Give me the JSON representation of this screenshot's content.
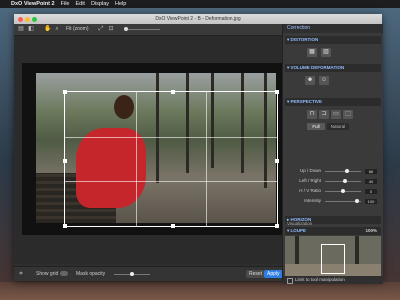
{
  "menubar": {
    "apple": "",
    "app_name": "DxO ViewPoint 2",
    "items": [
      "File",
      "Edit",
      "Display",
      "Help"
    ]
  },
  "window": {
    "title": "DxO ViewPoint 2 - B - Deformation.jpg"
  },
  "toolbar": {
    "zoom_label": "Fit (zoom)"
  },
  "canvas": {
    "dimensions": "2272 × 1515 px"
  },
  "bottombar": {
    "show_grid_label": "Show grid",
    "mask_opacity_label": "Mask opacity",
    "mask_opacity": 0.5,
    "reset_label": "Reset",
    "apply_label": "Apply"
  },
  "panel": {
    "header": "Correction",
    "sections": {
      "distortion": "DISTORTION",
      "volume": "VOLUME DEFORMATION",
      "perspective": "PERSPECTIVE",
      "horizon": "HORIZON",
      "loupe": "LOUPE"
    },
    "perspective_modes": [
      "Full",
      "Natural"
    ],
    "perspective_selected": "Full",
    "sliders": [
      {
        "label": "Up / Down",
        "value": "66",
        "level": 0.62
      },
      {
        "label": "Left / Right",
        "value": "40",
        "level": 0.55
      },
      {
        "label": "H / V Ratio",
        "value": "0",
        "level": 0.5
      },
      {
        "label": "Intensity",
        "value": "100",
        "level": 0.9
      }
    ],
    "visualization": "Visualization",
    "loupe_zoom": "100%",
    "limit_label": "Limit to tool manipulation"
  },
  "colors": {
    "accent": "#2f7de1",
    "section_text": "#8fbcff"
  }
}
